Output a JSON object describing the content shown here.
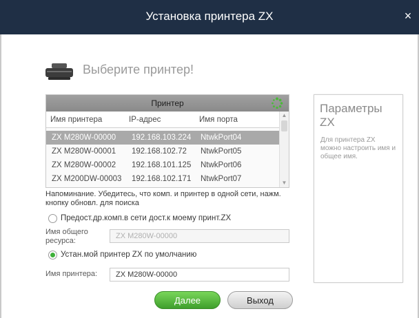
{
  "window": {
    "title": "Установка принтера ZX",
    "close_glyph": "×"
  },
  "heading": {
    "text": "Выберите принтер!",
    "icon": "printer-icon"
  },
  "printer_table": {
    "header": "Принтер",
    "refresh_icon": "refresh-icon",
    "columns": [
      "Имя принтера",
      "IP-адрес",
      "Имя порта"
    ],
    "rows": [
      {
        "name": "ZX M280W-00000",
        "ip": "192.168.103.224",
        "port": "NtwkPort04",
        "selected": true
      },
      {
        "name": "ZX M280W-00001",
        "ip": "192.168.102.72",
        "port": "NtwkPort05",
        "selected": false
      },
      {
        "name": "ZX M280W-00002",
        "ip": "192.168.101.125",
        "port": "NtwkPort06",
        "selected": false
      },
      {
        "name": "ZX M200DW-00003",
        "ip": "192.168.102.171",
        "port": "NtwkPort07",
        "selected": false
      }
    ]
  },
  "notice": "Напоминание. Убедитесь, что комп. и принтер в одной сети, нажм. кнопку обновл. для поиска",
  "share_option": {
    "label": "Предост.др.комп.в сети дост.к моему принт.ZX",
    "checked": false
  },
  "share_name": {
    "label": "Имя общего ресурса:",
    "value": "ZX M280W-00000"
  },
  "default_option": {
    "label": "Устан.мой принтер ZX по умолчанию",
    "checked": true
  },
  "printer_name": {
    "label": "Имя принтера:",
    "value": "ZX M280W-00000"
  },
  "params": {
    "title": "Параметры ZX",
    "text": "Для принтера ZX можно настроить имя и общее имя."
  },
  "buttons": {
    "next": "Далее",
    "exit": "Выход"
  },
  "colors": {
    "titlebar": "#1f2f45",
    "accent_green": "#3f9f2c",
    "selected_row": "#a9a9a9"
  }
}
